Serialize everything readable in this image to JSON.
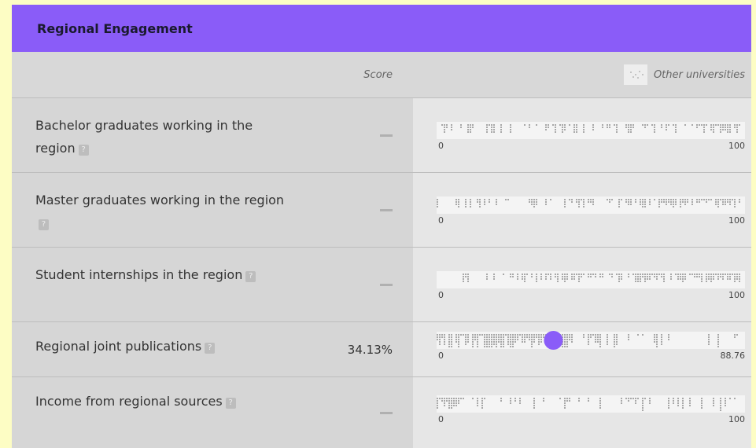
{
  "panel": {
    "title": "Regional Engagement",
    "header_color": "#8a5cf8"
  },
  "columns": {
    "score": "Score",
    "others": "Other universities"
  },
  "rows": [
    {
      "label": "Bachelor graduates working in the region",
      "score": "",
      "min": "0",
      "max": "100",
      "seed": 11
    },
    {
      "label": "Master graduates working in the region",
      "score": "",
      "min": "0",
      "max": "100",
      "seed": 23
    },
    {
      "label": "Student internships in the region",
      "score": "",
      "min": "0",
      "max": "100",
      "seed": 37
    },
    {
      "label": "Regional joint publications",
      "score": "34.13%",
      "min": "0",
      "max": "88.76",
      "seed": 51,
      "highlight_value": 34.13,
      "highlight_max": 88.76
    },
    {
      "label": "Income from regional sources",
      "score": "",
      "min": "0",
      "max": "100",
      "seed": 67
    }
  ],
  "colors": {
    "dots": "#a8a8a8",
    "highlight": "#8a5cf8"
  }
}
